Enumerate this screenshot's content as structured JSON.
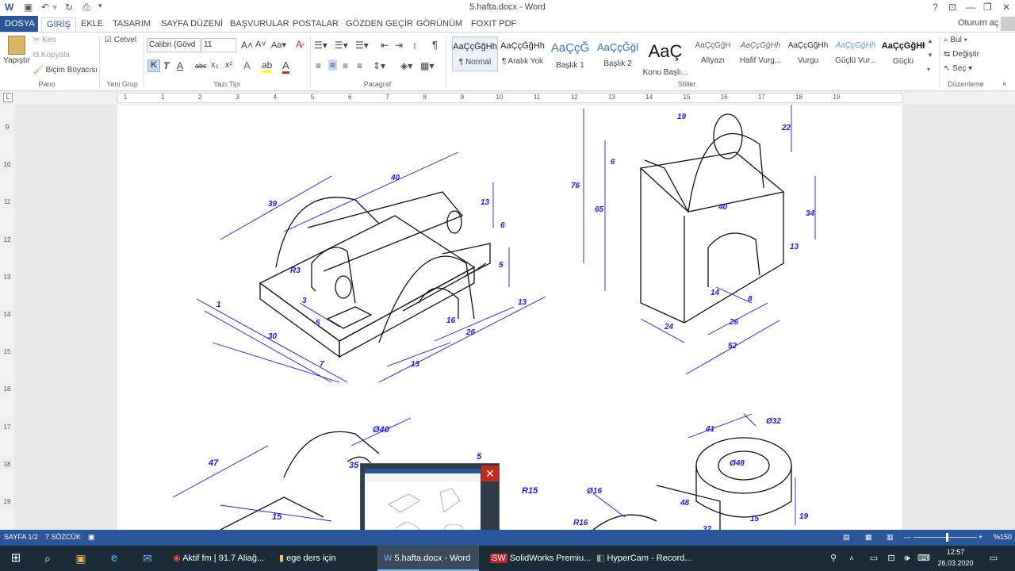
{
  "window": {
    "title": "5.hafta.docx - Word",
    "help": "?",
    "sign_in": "Oturum aç"
  },
  "tabs": [
    "DOSYA",
    "GİRİŞ",
    "EKLE",
    "TASARIM",
    "SAYFA DÜZENİ",
    "BAŞVURULAR",
    "POSTALAR",
    "GÖZDEN GEÇİR",
    "GÖRÜNÜM",
    "FOXIT PDF"
  ],
  "ribbon": {
    "clipboard": {
      "paste": "Yapıştır",
      "cut": "Kes",
      "copy": "Kopyala",
      "format_painter": "Biçim Boyacısı",
      "label": "Pano"
    },
    "new_group": {
      "ruler": "Cetvel",
      "label": "Yeni Grup"
    },
    "font": {
      "name": "Calibri (Gövd",
      "size": "11",
      "bold": "K",
      "italic": "T",
      "underline": "A",
      "strike": "abc",
      "sub": "x₂",
      "sup": "x²",
      "label": "Yazı Tipi"
    },
    "paragraph": {
      "label": "Paragraf"
    },
    "styles": {
      "label": "Stiller",
      "items": [
        {
          "sample": "AaÇçĞğHh",
          "name": "¶ Normal"
        },
        {
          "sample": "AaÇçĞğHh",
          "name": "¶ Aralık Yok"
        },
        {
          "sample": "AaÇçĞ",
          "name": "Başlık 1"
        },
        {
          "sample": "AaÇçĞğl",
          "name": "Başlık 2"
        },
        {
          "sample": "AaÇ",
          "name": "Konu Başlı..."
        },
        {
          "sample": "AaÇçĞğH",
          "name": "Altyazı"
        },
        {
          "sample": "AaÇçĞğHh",
          "name": "Hafif Vurg..."
        },
        {
          "sample": "AaÇçĞğHh",
          "name": "Vurgu"
        },
        {
          "sample": "AaÇçĞğHh",
          "name": "Güçlü Vur..."
        },
        {
          "sample": "AaÇçĞğHł",
          "name": "Güçlü"
        }
      ]
    },
    "editing": {
      "find": "Bul",
      "replace": "Değiştir",
      "select": "Seç",
      "label": "Düzenleme"
    }
  },
  "ruler_numbers": [
    "1",
    "1",
    "2",
    "3",
    "4",
    "5",
    "6",
    "7",
    "8",
    "9",
    "10",
    "11",
    "12",
    "13",
    "14",
    "15",
    "16",
    "17",
    "18",
    "19"
  ],
  "vruler_numbers": [
    "9",
    "10",
    "11",
    "12",
    "13",
    "14",
    "15",
    "16",
    "17",
    "18",
    "19"
  ],
  "drawing": {
    "dims_top_left": [
      "39",
      "40",
      "13",
      "6",
      "5",
      "13",
      "26",
      "16",
      "13",
      "7",
      "30",
      "1",
      "5",
      "3",
      "R3"
    ],
    "dims_top_right": [
      "19",
      "22",
      "6",
      "76",
      "65",
      "40",
      "34",
      "13",
      "14",
      "8",
      "26",
      "24",
      "52"
    ],
    "dims_bottom_left": [
      "47",
      "Ø40",
      "35",
      "15",
      "5",
      "R15"
    ],
    "dims_bottom_right": [
      "41",
      "Ø32",
      "Ø48",
      "Ø16",
      "48",
      "R16",
      "32",
      "15",
      "19"
    ]
  },
  "status": {
    "page": "SAYFA 1/2",
    "words": "7 SÖZCÜK",
    "zoom": "%150"
  },
  "taskbar": {
    "items": [
      "Aktif fm | 91.7 Aliağ...",
      "ege ders için",
      "5.hafta.docx - Word",
      "SolidWorks Premiu...",
      "HyperCam - Record..."
    ],
    "time": "12:57",
    "date": "26.03.2020"
  },
  "colors": {
    "accent": "#2b579a",
    "dimension": "#1a1aee",
    "taskbar": "#1c2b38"
  }
}
